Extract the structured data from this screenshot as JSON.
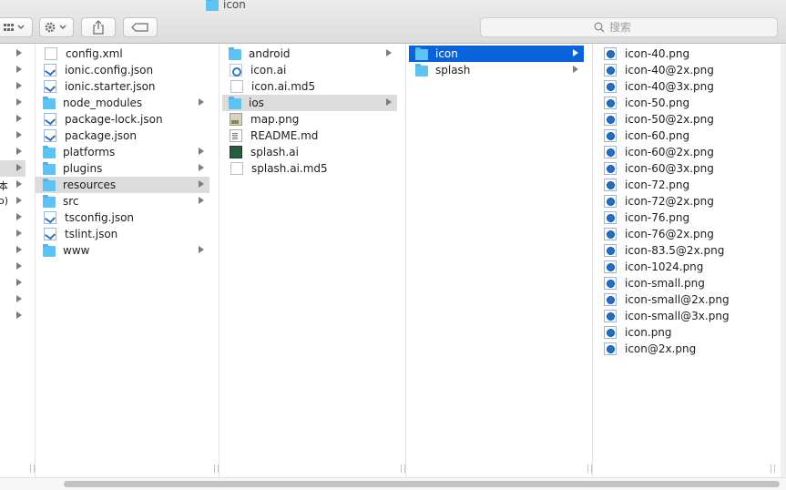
{
  "window": {
    "title": "icon"
  },
  "toolbar": {
    "view_icon": "grid-view-icon",
    "action_icon": "gear-icon",
    "share_icon": "share-icon",
    "tag_icon": "tag-icon"
  },
  "search": {
    "placeholder": "搜索"
  },
  "sidebar": {
    "labels": [
      "本",
      "o)"
    ]
  },
  "col1": {
    "items": [
      {
        "label": "config.xml",
        "icon": "doc",
        "has_children": false
      },
      {
        "label": "ionic.config.json",
        "icon": "vsc",
        "has_children": false
      },
      {
        "label": "ionic.starter.json",
        "icon": "vsc",
        "has_children": false
      },
      {
        "label": "node_modules",
        "icon": "folder",
        "has_children": true
      },
      {
        "label": "package-lock.json",
        "icon": "vsc",
        "has_children": false
      },
      {
        "label": "package.json",
        "icon": "vsc",
        "has_children": false
      },
      {
        "label": "platforms",
        "icon": "folder",
        "has_children": true
      },
      {
        "label": "plugins",
        "icon": "folder",
        "has_children": true
      },
      {
        "label": "resources",
        "icon": "folder",
        "has_children": true
      },
      {
        "label": "src",
        "icon": "folder",
        "has_children": true
      },
      {
        "label": "tsconfig.json",
        "icon": "vsc",
        "has_children": false
      },
      {
        "label": "tslint.json",
        "icon": "vsc",
        "has_children": false
      },
      {
        "label": "www",
        "icon": "folder",
        "has_children": true
      }
    ],
    "selected": "resources"
  },
  "col2": {
    "items": [
      {
        "label": "android",
        "icon": "folder",
        "has_children": true
      },
      {
        "label": "icon.ai",
        "icon": "ai",
        "has_children": false
      },
      {
        "label": "icon.ai.md5",
        "icon": "doc",
        "has_children": false
      },
      {
        "label": "ios",
        "icon": "folder",
        "has_children": true
      },
      {
        "label": "map.png",
        "icon": "img",
        "has_children": false
      },
      {
        "label": "README.md",
        "icon": "txt",
        "has_children": false
      },
      {
        "label": "splash.ai",
        "icon": "splash",
        "has_children": false
      },
      {
        "label": "splash.ai.md5",
        "icon": "doc",
        "has_children": false
      }
    ],
    "selected": "ios"
  },
  "col3": {
    "items": [
      {
        "label": "icon",
        "icon": "folder",
        "has_children": true
      },
      {
        "label": "splash",
        "icon": "folder",
        "has_children": true
      }
    ],
    "selected": "icon"
  },
  "col4": {
    "items": [
      {
        "label": "icon-40.png",
        "icon": "png"
      },
      {
        "label": "icon-40@2x.png",
        "icon": "png"
      },
      {
        "label": "icon-40@3x.png",
        "icon": "png"
      },
      {
        "label": "icon-50.png",
        "icon": "png"
      },
      {
        "label": "icon-50@2x.png",
        "icon": "png"
      },
      {
        "label": "icon-60.png",
        "icon": "png"
      },
      {
        "label": "icon-60@2x.png",
        "icon": "png"
      },
      {
        "label": "icon-60@3x.png",
        "icon": "png"
      },
      {
        "label": "icon-72.png",
        "icon": "png"
      },
      {
        "label": "icon-72@2x.png",
        "icon": "png"
      },
      {
        "label": "icon-76.png",
        "icon": "png"
      },
      {
        "label": "icon-76@2x.png",
        "icon": "png"
      },
      {
        "label": "icon-83.5@2x.png",
        "icon": "png"
      },
      {
        "label": "icon-1024.png",
        "icon": "png"
      },
      {
        "label": "icon-small.png",
        "icon": "png"
      },
      {
        "label": "icon-small@2x.png",
        "icon": "png"
      },
      {
        "label": "icon-small@3x.png",
        "icon": "png"
      },
      {
        "label": "icon.png",
        "icon": "png"
      },
      {
        "label": "icon@2x.png",
        "icon": "png"
      }
    ]
  },
  "colors": {
    "selection_blue": "#0b63dc",
    "selection_gray": "#dcdcdc",
    "folder_blue": "#5ec3f2"
  }
}
